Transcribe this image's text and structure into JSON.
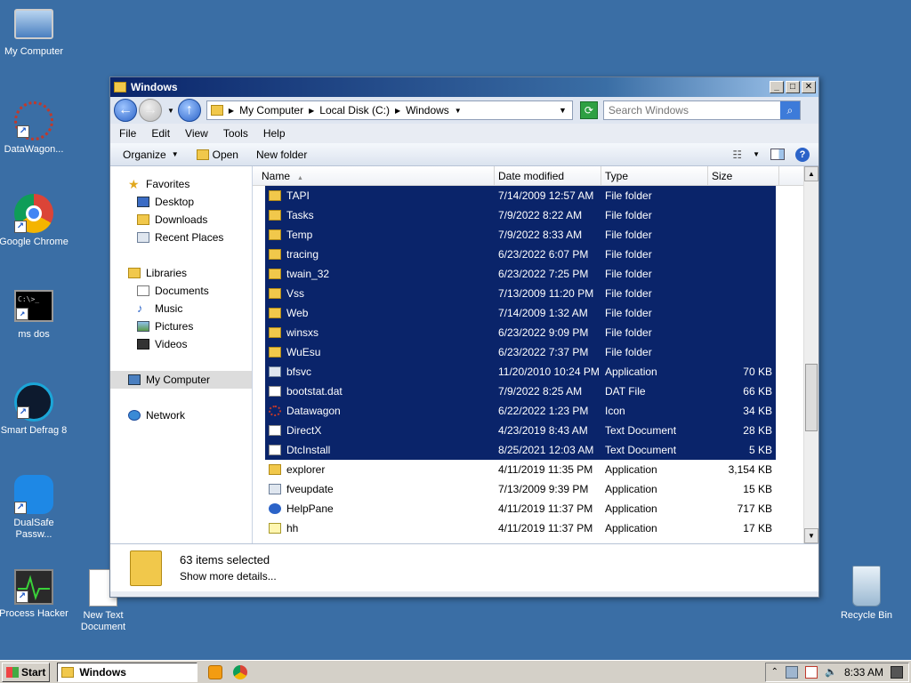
{
  "desktop": {
    "icons": [
      {
        "label": "My Computer"
      },
      {
        "label": "DataWagon..."
      },
      {
        "label": "Google Chrome"
      },
      {
        "label": "ms dos"
      },
      {
        "label": "Smart Defrag 8"
      },
      {
        "label": "DualSafe Passw..."
      },
      {
        "label": "Process Hacker"
      },
      {
        "label": "New Text Document"
      },
      {
        "label": "Recycle Bin"
      }
    ]
  },
  "window": {
    "title": "Windows",
    "address": {
      "crumbs": [
        "My Computer",
        "Local Disk (C:)",
        "Windows"
      ]
    },
    "search": {
      "placeholder": "Search Windows"
    },
    "menu": [
      "File",
      "Edit",
      "View",
      "Tools",
      "Help"
    ],
    "toolbar": {
      "organize": "Organize",
      "open": "Open",
      "new_folder": "New folder"
    },
    "nav": {
      "favorites": "Favorites",
      "desktop": "Desktop",
      "downloads": "Downloads",
      "recent": "Recent Places",
      "libraries": "Libraries",
      "documents": "Documents",
      "music": "Music",
      "pictures": "Pictures",
      "videos": "Videos",
      "computer": "My Computer",
      "network": "Network"
    },
    "columns": {
      "name": "Name",
      "date": "Date modified",
      "type": "Type",
      "size": "Size"
    },
    "files": [
      {
        "name": "TAPI",
        "date": "7/14/2009 12:57 AM",
        "type": "File folder",
        "size": "",
        "icon": "folder",
        "selected": true
      },
      {
        "name": "Tasks",
        "date": "7/9/2022 8:22 AM",
        "type": "File folder",
        "size": "",
        "icon": "folder",
        "selected": true
      },
      {
        "name": "Temp",
        "date": "7/9/2022 8:33 AM",
        "type": "File folder",
        "size": "",
        "icon": "folder",
        "selected": true
      },
      {
        "name": "tracing",
        "date": "6/23/2022 6:07 PM",
        "type": "File folder",
        "size": "",
        "icon": "folder",
        "selected": true
      },
      {
        "name": "twain_32",
        "date": "6/23/2022 7:25 PM",
        "type": "File folder",
        "size": "",
        "icon": "folder",
        "selected": true
      },
      {
        "name": "Vss",
        "date": "7/13/2009 11:20 PM",
        "type": "File folder",
        "size": "",
        "icon": "folder",
        "selected": true
      },
      {
        "name": "Web",
        "date": "7/14/2009 1:32 AM",
        "type": "File folder",
        "size": "",
        "icon": "folder",
        "selected": true
      },
      {
        "name": "winsxs",
        "date": "6/23/2022 9:09 PM",
        "type": "File folder",
        "size": "",
        "icon": "folder",
        "selected": true
      },
      {
        "name": "WuEsu",
        "date": "6/23/2022 7:37 PM",
        "type": "File folder",
        "size": "",
        "icon": "folder",
        "selected": true
      },
      {
        "name": "bfsvc",
        "date": "11/20/2010 10:24 PM",
        "type": "Application",
        "size": "70 KB",
        "icon": "app",
        "selected": true
      },
      {
        "name": "bootstat.dat",
        "date": "7/9/2022 8:25 AM",
        "type": "DAT File",
        "size": "66 KB",
        "icon": "file",
        "selected": true
      },
      {
        "name": "Datawagon",
        "date": "6/22/2022 1:23 PM",
        "type": "Icon",
        "size": "34 KB",
        "icon": "icon",
        "selected": true
      },
      {
        "name": "DirectX",
        "date": "4/23/2019 8:43 AM",
        "type": "Text Document",
        "size": "28 KB",
        "icon": "file",
        "selected": true
      },
      {
        "name": "DtcInstall",
        "date": "8/25/2021 12:03 AM",
        "type": "Text Document",
        "size": "5 KB",
        "icon": "file",
        "selected": true
      },
      {
        "name": "explorer",
        "date": "4/11/2019 11:35 PM",
        "type": "Application",
        "size": "3,154 KB",
        "icon": "folder",
        "selected": false
      },
      {
        "name": "fveupdate",
        "date": "7/13/2009 9:39 PM",
        "type": "Application",
        "size": "15 KB",
        "icon": "app",
        "selected": false
      },
      {
        "name": "HelpPane",
        "date": "4/11/2019 11:37 PM",
        "type": "Application",
        "size": "717 KB",
        "icon": "help",
        "selected": false
      },
      {
        "name": "hh",
        "date": "4/11/2019 11:37 PM",
        "type": "Application",
        "size": "17 KB",
        "icon": "hh",
        "selected": false
      }
    ],
    "details": {
      "count": "63 items selected",
      "more": "Show more details..."
    }
  },
  "taskbar": {
    "start": "Start",
    "task": "Windows",
    "clock": "8:33 AM"
  }
}
